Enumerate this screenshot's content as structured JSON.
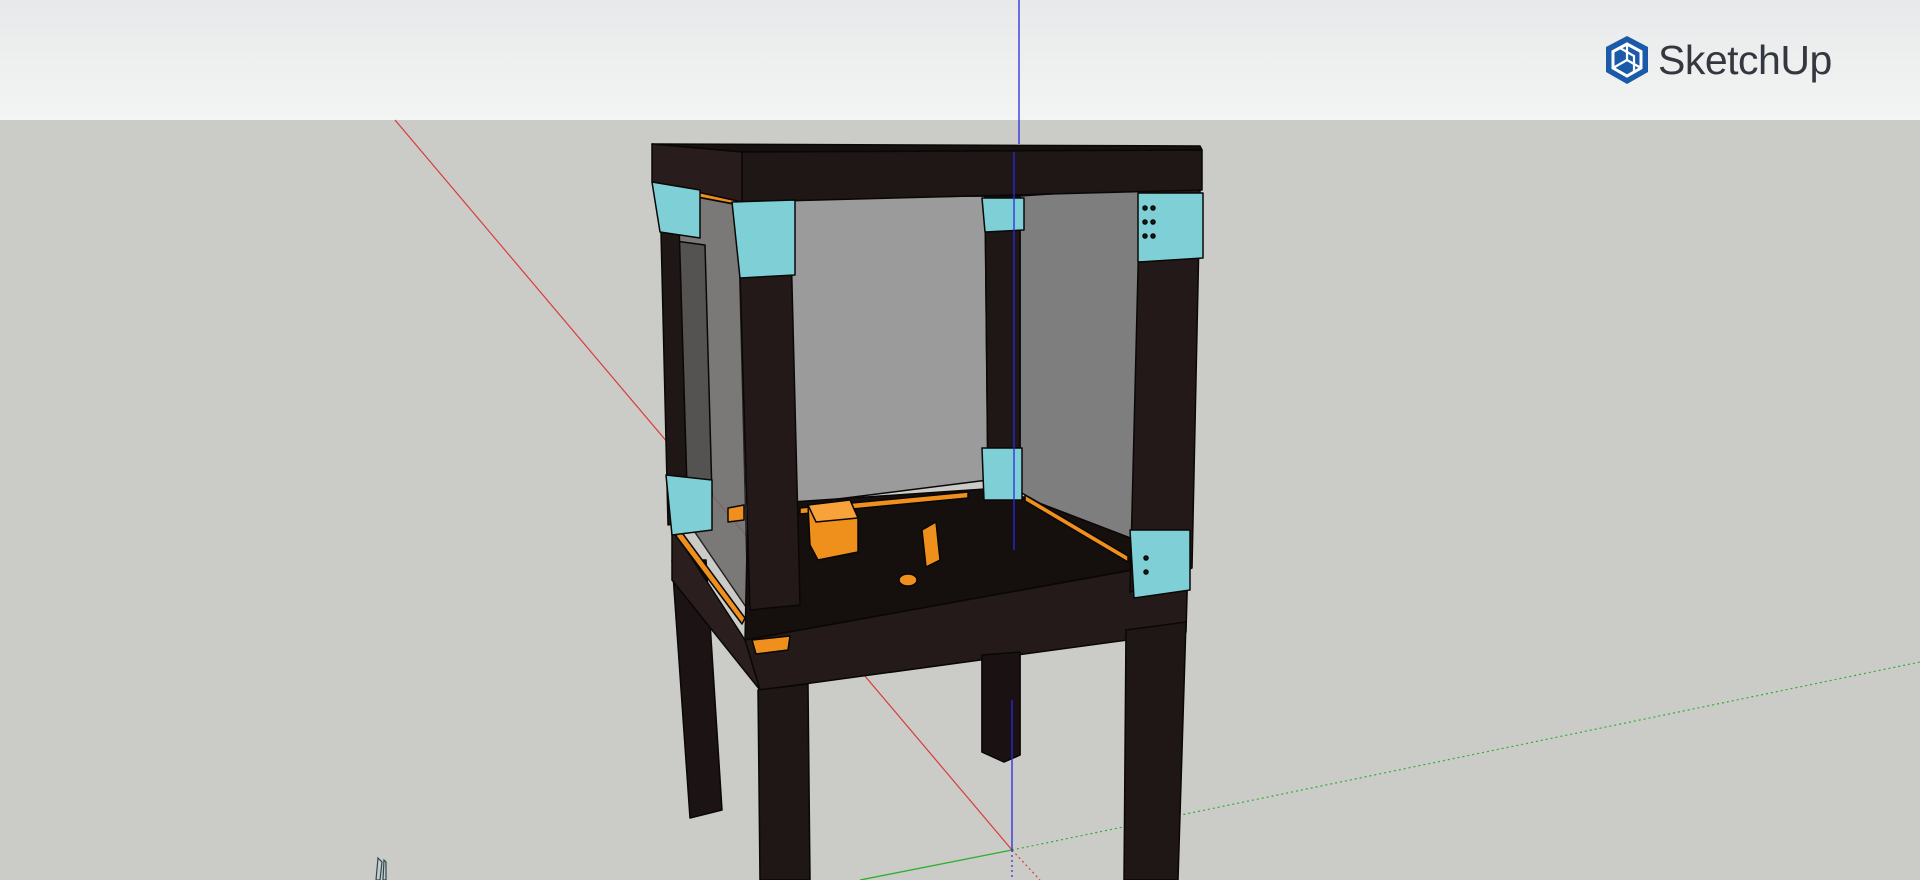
{
  "app": {
    "brand_name": "SketchUp",
    "logo_icon": "sketchup-cube-icon"
  },
  "colors": {
    "sky_top": "#e7e9ea",
    "ground": "#cbccc7",
    "frame_wood": "#1f1616",
    "frame_edge": "#0a0707",
    "glass_back": "#9a9a9a",
    "glass_side": "#7c7c7c",
    "bracket": "#7fd0d6",
    "accent_orange": "#f0901c",
    "axis_red": "#d93b3b",
    "axis_green": "#2fae2f",
    "axis_blue": "#2a2ae0",
    "brand_blue": "#1a5aa8"
  }
}
